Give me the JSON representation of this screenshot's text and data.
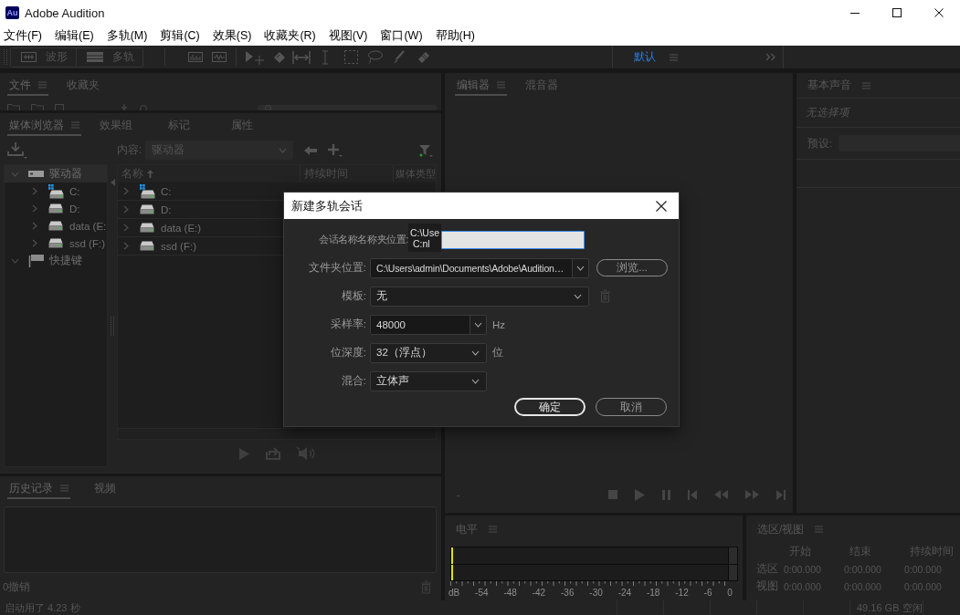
{
  "window": {
    "logo": "Au",
    "title": "Adobe Audition"
  },
  "menu": [
    "文件(F)",
    "编辑(E)",
    "多轨(M)",
    "剪辑(C)",
    "效果(S)",
    "收藏夹(R)",
    "视图(V)",
    "窗口(W)",
    "帮助(H)"
  ],
  "toolbar": {
    "view_buttons": [
      {
        "label": "波形",
        "kind": "waveform"
      },
      {
        "label": "多轨",
        "kind": "multitrack"
      }
    ],
    "workspace": "默认"
  },
  "files_panel": {
    "tabs": [
      {
        "label": "文件",
        "selected": true
      },
      {
        "label": "收藏夹",
        "selected": false
      }
    ]
  },
  "media_browser": {
    "tabs": [
      {
        "label": "媒体浏览器",
        "selected": true
      },
      {
        "label": "效果组",
        "selected": false
      },
      {
        "label": "标记",
        "selected": false
      },
      {
        "label": "属性",
        "selected": false
      }
    ],
    "content_label": "内容:",
    "content_value": "驱动器",
    "tree": [
      {
        "label": "驱动器",
        "kind": "drives",
        "expanded": true,
        "selected": true,
        "children": [
          {
            "label": "C:",
            "kind": "system-drive",
            "expanded": false,
            "selected": false
          },
          {
            "label": "D:",
            "kind": "drive",
            "expanded": false,
            "selected": false
          },
          {
            "label": "data (E:",
            "kind": "drive",
            "expanded": false,
            "selected": false
          },
          {
            "label": "ssd (F:)",
            "kind": "drive",
            "expanded": false,
            "selected": false
          }
        ]
      },
      {
        "label": "快捷键",
        "kind": "shortcuts",
        "expanded": true,
        "selected": false
      }
    ],
    "columns": [
      {
        "label": "名称",
        "sorted": true
      },
      {
        "label": "持续时间",
        "sorted": false
      },
      {
        "label": "媒体类型",
        "sorted": false
      }
    ],
    "rows": [
      {
        "name": "C:",
        "kind": "system-drive"
      },
      {
        "name": "D:",
        "kind": "drive"
      },
      {
        "name": "data (E:)",
        "kind": "drive"
      },
      {
        "name": "ssd (F:)",
        "kind": "drive"
      }
    ]
  },
  "history_panel": {
    "tabs": [
      {
        "label": "历史记录",
        "selected": true
      },
      {
        "label": "视频",
        "selected": false
      }
    ],
    "undo_count": "0撤销"
  },
  "editor_panel": {
    "tabs": [
      {
        "label": "编辑器",
        "selected": true
      },
      {
        "label": "混音器",
        "selected": false
      }
    ],
    "time": "-"
  },
  "basic_sound_panel": {
    "title": "基本声音",
    "empty_text": "无选择项",
    "preset_label": "预设:"
  },
  "levels_panel": {
    "title": "电平",
    "channels": [
      {
        "level": 0
      },
      {
        "level": 0
      }
    ],
    "scale": [
      "dB",
      "-54",
      "-48",
      "-42",
      "-36",
      "-30",
      "-24",
      "-18",
      "-12",
      "-6",
      "0"
    ]
  },
  "selection_panel": {
    "title": "选区/视图",
    "columns": [
      "开始",
      "结束",
      "持续时间"
    ],
    "rows": [
      {
        "label": "选区",
        "values": [
          "0:00.000",
          "0:00.000",
          "0:00.000"
        ]
      },
      {
        "label": "视图",
        "values": [
          "0:00.000",
          "0:00.000",
          "0:00.000"
        ]
      }
    ]
  },
  "status_bar": {
    "startup": "启动用了 4.23 秒",
    "free_space": "49.16 GB 空闲"
  },
  "dialog": {
    "title": "新建多轨会话",
    "fields": [
      {
        "kind": "text",
        "label": "会话名称名称夹位置:",
        "focused": true,
        "suggestions": [
          "C:\\Use",
          "C:nl"
        ]
      },
      {
        "kind": "combo",
        "label": "文件夹位置:",
        "value": "C:\\Users\\admin\\Documents\\Adobe\\Audition…",
        "button": "浏览..."
      },
      {
        "kind": "dropdown",
        "label": "模板:",
        "value": "无",
        "delete": {
          "disabled": true
        }
      },
      {
        "kind": "combo",
        "label": "采样率:",
        "value": "48000",
        "unit": "Hz"
      },
      {
        "kind": "dropdown",
        "label": "位深度:",
        "value": "32（浮点）",
        "unit": "位"
      },
      {
        "kind": "dropdown",
        "label": "混合:",
        "value": "立体声"
      }
    ],
    "buttons": [
      {
        "label": "确定",
        "default": true
      },
      {
        "label": "取消",
        "default": false
      }
    ]
  }
}
